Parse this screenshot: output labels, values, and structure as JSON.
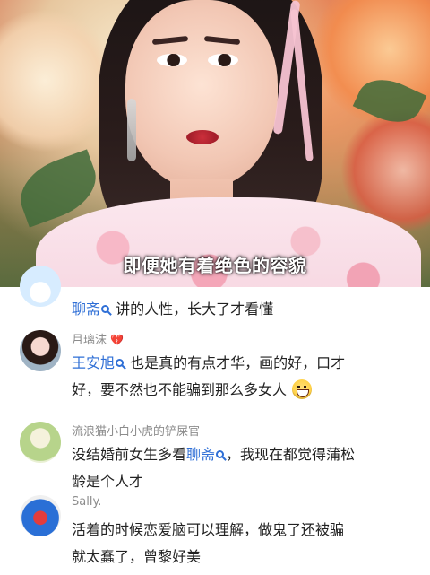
{
  "video": {
    "subtitle": "即便她有着绝色的容貌"
  },
  "comments": [
    {
      "username": "",
      "segments": [
        {
          "type": "mention",
          "text": "聊斋"
        },
        {
          "type": "text",
          "text": "讲的人性，长大了才看懂"
        }
      ]
    },
    {
      "username": "月璃沫",
      "username_icon": "broken-heart-icon",
      "line1": [
        {
          "type": "mention",
          "text": "王安旭"
        },
        {
          "type": "text",
          "text": "也是真的有点才华，画的好，口才"
        }
      ],
      "line2": [
        {
          "type": "text",
          "text": "好，要不然也不能骗到那么多女人"
        },
        {
          "type": "emoji",
          "name": "grinning-emoji-icon"
        }
      ]
    },
    {
      "username": "流浪猫小白小虎的铲屎官",
      "line1": [
        {
          "type": "text",
          "text": "没结婚前女生多看"
        },
        {
          "type": "mention",
          "text": "聊斋"
        },
        {
          "type": "text",
          "text": "，我现在都觉得蒲松"
        }
      ],
      "line2": [
        {
          "type": "text",
          "text": "龄是个人才"
        }
      ]
    },
    {
      "username": "Sally.",
      "line1": [
        {
          "type": "text",
          "text": "活着的时候恋爱脑可以理解，做鬼了还被骗"
        }
      ],
      "line2": [
        {
          "type": "text",
          "text": "就太蠢了，曾黎好美"
        }
      ]
    }
  ]
}
